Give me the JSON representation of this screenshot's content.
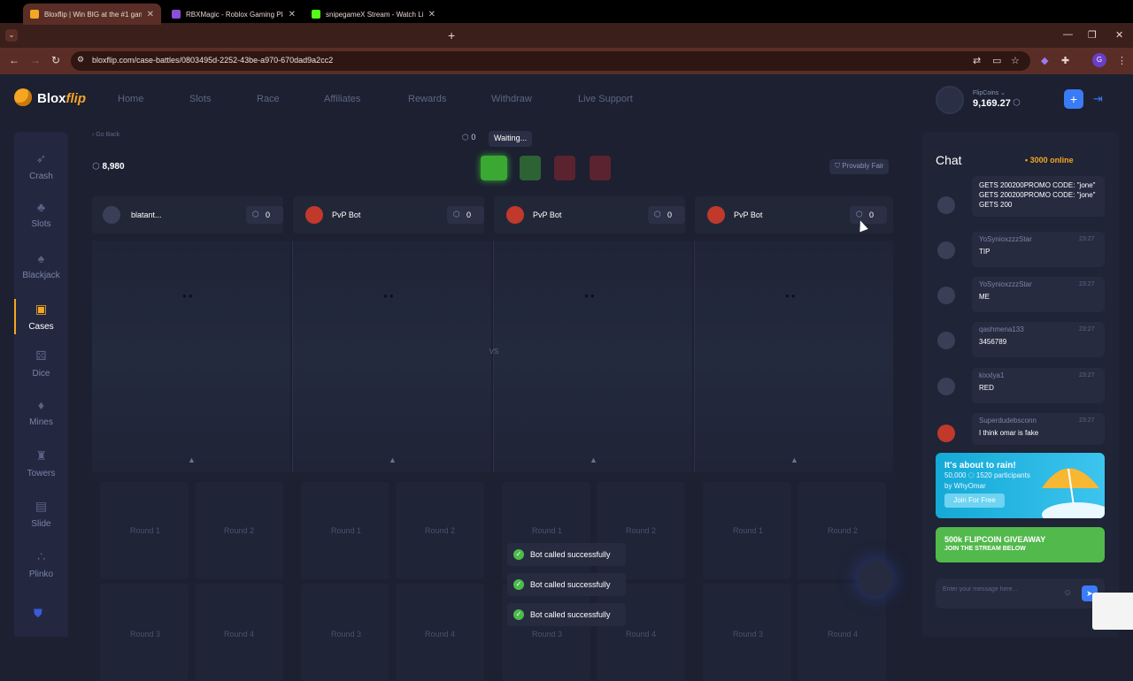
{
  "browser": {
    "tabs": [
      {
        "title": "Bloxflip | Win BIG at the #1 game",
        "fav": "#f5a623"
      },
      {
        "title": "RBXMagic - Roblox Gaming Pla",
        "fav": "#8a4fd6"
      },
      {
        "title": "snipegameX Stream - Watch Li",
        "fav": "#53fc18"
      }
    ],
    "url": "bloxflip.com/case-battles/0803495d-2252-43be-a970-670dad9a2cc2",
    "profile_initial": "G"
  },
  "header": {
    "logo_main": "Blox",
    "logo_accent": "flip",
    "nav": [
      "Home",
      "Slots",
      "Race",
      "Affiliates",
      "Rewards",
      "Withdraw",
      "Live Support"
    ],
    "coins_label": "FlipCoins",
    "coins_value": "9,169.27"
  },
  "sidebar": {
    "items": [
      {
        "label": "Crash",
        "icon": "rocket-icon"
      },
      {
        "label": "Slots",
        "icon": "slots-icon"
      },
      {
        "label": "Blackjack",
        "icon": "cards-icon"
      },
      {
        "label": "Cases",
        "icon": "chest-icon"
      },
      {
        "label": "Dice",
        "icon": "dice-icon"
      },
      {
        "label": "Mines",
        "icon": "diamond-icon"
      },
      {
        "label": "Towers",
        "icon": "tower-icon"
      },
      {
        "label": "Slide",
        "icon": "slide-icon"
      },
      {
        "label": "Plinko",
        "icon": "plinko-icon"
      }
    ],
    "active": "Cases"
  },
  "battle": {
    "go_back": "Go Back",
    "total_value": "8,980",
    "pot": "0",
    "status": "Waiting...",
    "provably_fair": "Provably Fair",
    "vs": "VS",
    "players": [
      {
        "name": "blatant...",
        "value": "0"
      },
      {
        "name": "PvP Bot",
        "value": "0"
      },
      {
        "name": "PvP Bot",
        "value": "0"
      },
      {
        "name": "PvP Bot",
        "value": "0"
      }
    ],
    "rounds": [
      "Round 1",
      "Round 2",
      "Round 3",
      "Round 4"
    ],
    "toasts": [
      "Bot called successfully",
      "Bot called successfully",
      "Bot called successfully"
    ]
  },
  "chat": {
    "title": "Chat",
    "online": "3000 online",
    "messages": [
      {
        "user": "",
        "time": "",
        "text": "GETS 200200PROMO CODE: \"jone\" GETS 200200PROMO CODE: \"jone\" GETS 200"
      },
      {
        "user": "YoSynioxzzzStar",
        "time": "23:27",
        "text": "TIP"
      },
      {
        "user": "YoSynioxzzzStar",
        "time": "23:27",
        "text": "ME"
      },
      {
        "user": "qashmena133",
        "time": "23:27",
        "text": "3456789"
      },
      {
        "user": "kixxlya1",
        "time": "23:27",
        "text": "RED"
      },
      {
        "user": "Superdudebsconn",
        "time": "23:27",
        "text": "I think omar is fake"
      }
    ],
    "rain": {
      "title": "It's about to rain!",
      "amount": "50,000",
      "participants": "1520 participants",
      "by": "by WhyOmar",
      "button": "Join For Free"
    },
    "giveaway": {
      "line1": "500k FLIPCOIN GIVEAWAY",
      "line2": "JOIN THE STREAM BELOW"
    },
    "input_placeholder": "Enter your message here..."
  },
  "colors": {
    "accent": "#f5a623",
    "primary_button": "#3a7bf6",
    "background": "#1c2031",
    "success": "#4cbb4a"
  }
}
